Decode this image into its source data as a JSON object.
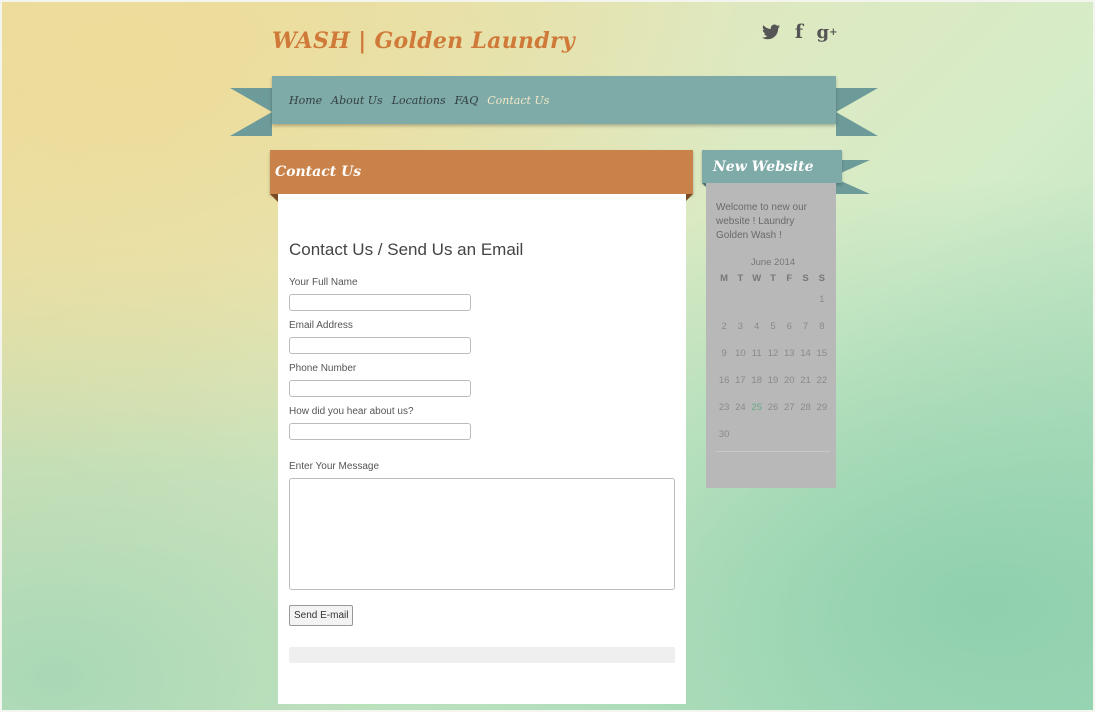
{
  "site": {
    "title": "WASH | Golden Laundry"
  },
  "social": [
    {
      "name": "twitter-icon",
      "glyph": "𝕪"
    },
    {
      "name": "facebook-icon",
      "glyph": "f"
    },
    {
      "name": "google-plus-icon",
      "glyph": "g⁺"
    }
  ],
  "nav": {
    "items": [
      {
        "label": "Home"
      },
      {
        "label": "About Us"
      },
      {
        "label": "Locations"
      },
      {
        "label": "FAQ"
      },
      {
        "label": "Contact Us",
        "active": true
      }
    ]
  },
  "main": {
    "header": "Contact Us",
    "form_title": "Contact Us / Send Us an Email",
    "fields": {
      "name_label": "Your Full Name",
      "email_label": "Email Address",
      "phone_label": "Phone Number",
      "hear_label": "How did you hear about us?",
      "message_label": "Enter Your Message"
    },
    "send_label": "Send E-mail"
  },
  "sidebar": {
    "header": "New Website",
    "welcome": "Welcome to new our website ! Laundry Golden Wash !",
    "calendar": {
      "caption": "June 2014",
      "days": [
        "M",
        "T",
        "W",
        "T",
        "F",
        "S",
        "S"
      ],
      "weeks": [
        [
          "",
          "",
          "",
          "",
          "",
          "",
          "1"
        ],
        [
          "2",
          "3",
          "4",
          "5",
          "6",
          "7",
          "8"
        ],
        [
          "9",
          "10",
          "11",
          "12",
          "13",
          "14",
          "15"
        ],
        [
          "16",
          "17",
          "18",
          "19",
          "20",
          "21",
          "22"
        ],
        [
          "23",
          "24",
          "25",
          "26",
          "27",
          "28",
          "29"
        ],
        [
          "30",
          "",
          "",
          "",
          "",
          "",
          ""
        ]
      ],
      "highlight": "25"
    }
  },
  "colors": {
    "title": "#d07a3a",
    "nav_ribbon": "#7eaaa8",
    "nav_active": "#f1e7c6",
    "main_header": "#c8824a",
    "sidebar_panel": "#b8b8b8",
    "calendar_today": "#6aaa8a"
  }
}
